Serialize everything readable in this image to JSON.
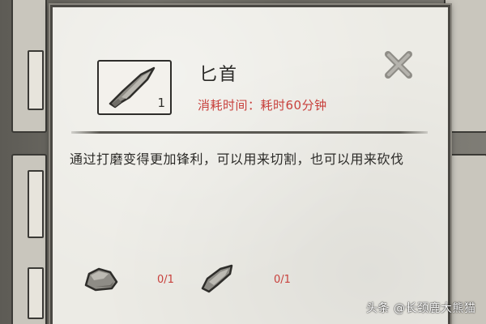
{
  "item": {
    "name": "匕首",
    "count": "1",
    "time_cost": "消耗时间：耗时60分钟",
    "description": "通过打磨变得更加锋利，可以用来切割，也可以用来砍伐",
    "icon": "dagger-icon"
  },
  "materials": [
    {
      "icon": "stone-icon",
      "count": "0/1"
    },
    {
      "icon": "flint-shard-icon",
      "count": "0/1"
    }
  ],
  "close": {
    "icon": "close-icon"
  },
  "watermark": "头条 @长颈鹿大熊猫",
  "colors": {
    "accent_red": "#c8403c",
    "text_dark": "#2b2a27",
    "paper": "#ecebe5"
  }
}
